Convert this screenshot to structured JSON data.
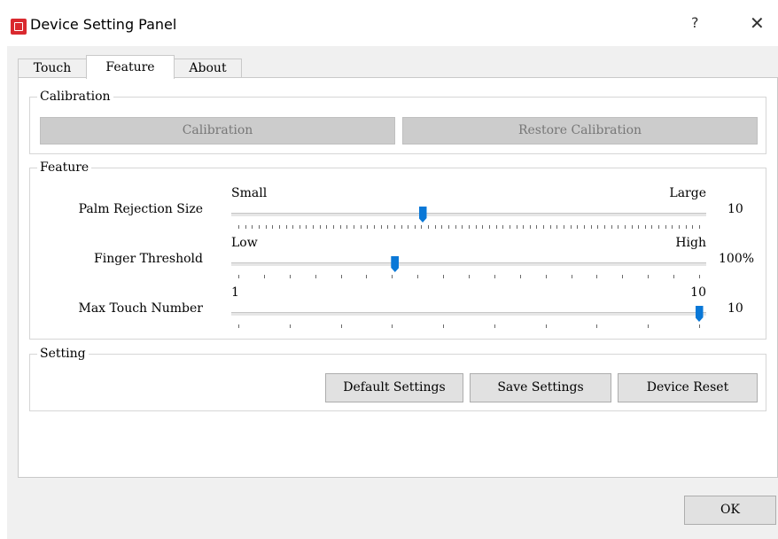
{
  "window": {
    "title": "Device Setting Panel",
    "help_label": "?",
    "close_label": "✕",
    "icon": "app-chip-icon"
  },
  "tabs": [
    {
      "label": "Touch",
      "active": false
    },
    {
      "label": "Feature",
      "active": true
    },
    {
      "label": "About",
      "active": false
    }
  ],
  "calibration": {
    "group_label": "Calibration",
    "calibration_button": "Calibration",
    "restore_button": "Restore Calibration",
    "buttons_enabled": false
  },
  "feature": {
    "group_label": "Feature",
    "sliders": [
      {
        "label": "Palm Rejection Size",
        "min_label": "Small",
        "max_label": "Large",
        "value_text": "10",
        "position": 0.4,
        "tick_count": 69
      },
      {
        "label": "Finger Threshold",
        "min_label": "Low",
        "max_label": "High",
        "value_text": "100%",
        "position": 0.34,
        "tick_count": 19
      },
      {
        "label": "Max Touch Number",
        "min_label": "1",
        "max_label": "10",
        "value_text": "10",
        "position": 1.0,
        "tick_count": 10
      }
    ]
  },
  "setting": {
    "group_label": "Setting",
    "default_button": "Default Settings",
    "save_button": "Save Settings",
    "reset_button": "Device Reset"
  },
  "footer": {
    "ok_button": "OK"
  },
  "colors": {
    "accent": "#0a78d7",
    "app_icon": "#d9292f",
    "disabled_button": "#cccccc"
  }
}
